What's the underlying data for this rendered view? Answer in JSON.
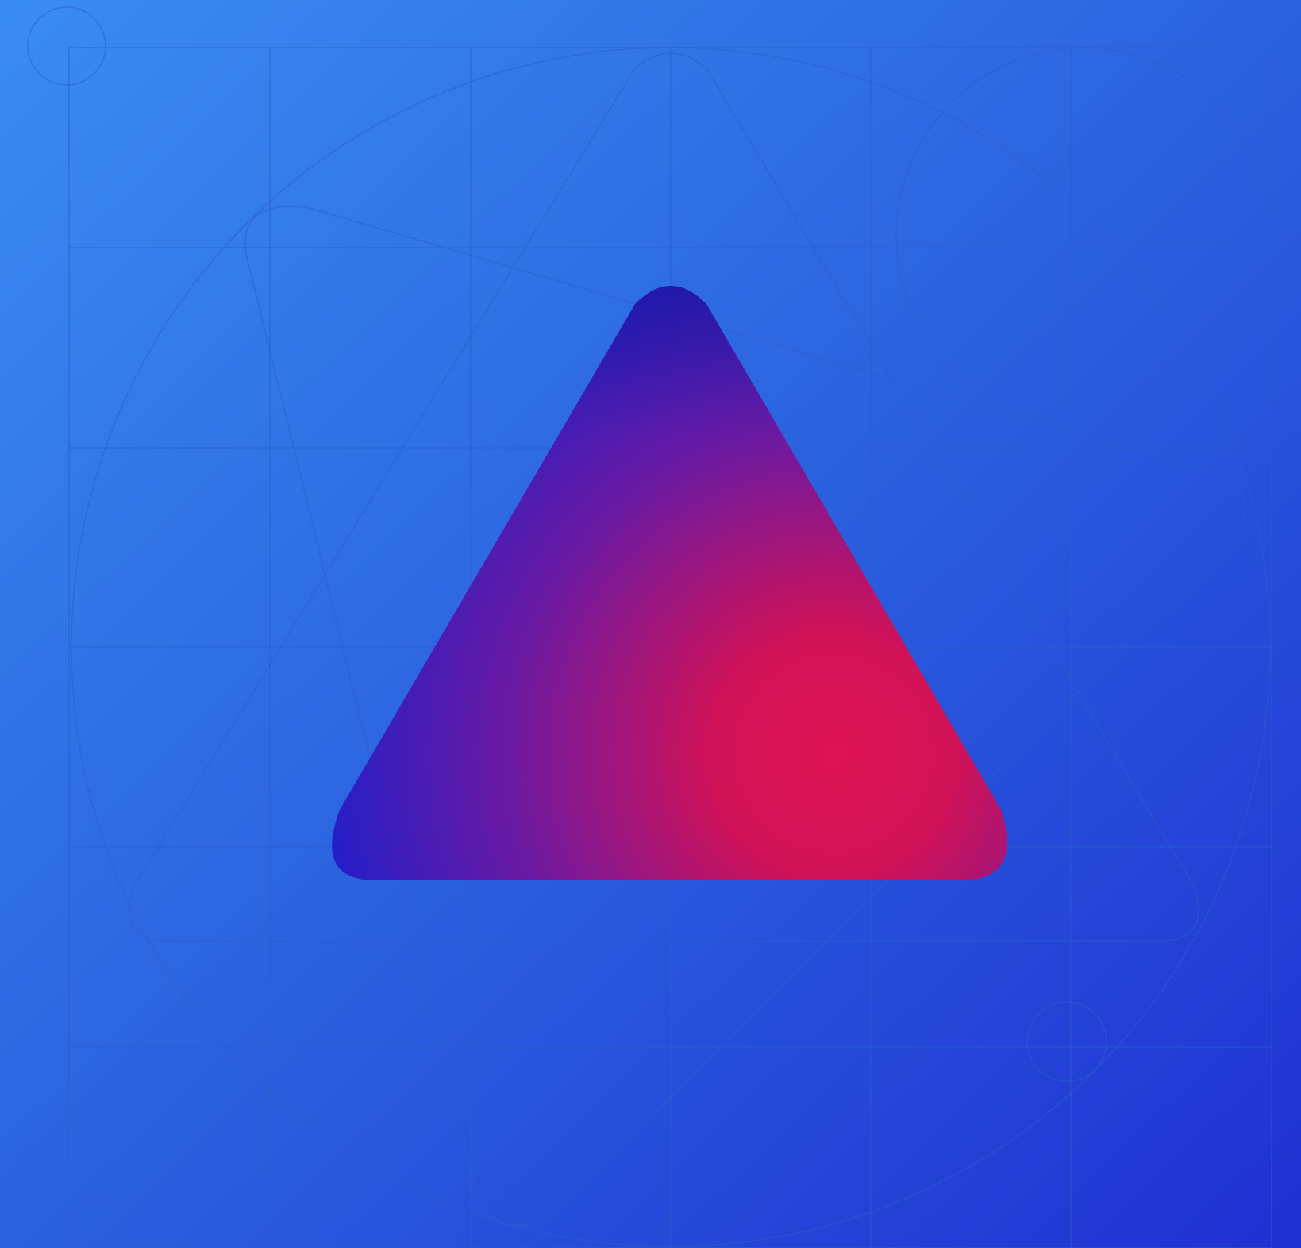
{
  "artwork": {
    "kind": "icon-illustration",
    "subject": "rounded-triangle-icon",
    "background": {
      "colors": [
        "#3a8cf3",
        "#2b62df",
        "#2030d2"
      ]
    },
    "construction_grid": {
      "columns": 6,
      "rows": 6,
      "line_color": "#2a5fd0",
      "line_opacity": 0.55
    },
    "triangle": {
      "colors": [
        "#1b1fcc",
        "#6a1aa3",
        "#dc1253"
      ]
    }
  }
}
